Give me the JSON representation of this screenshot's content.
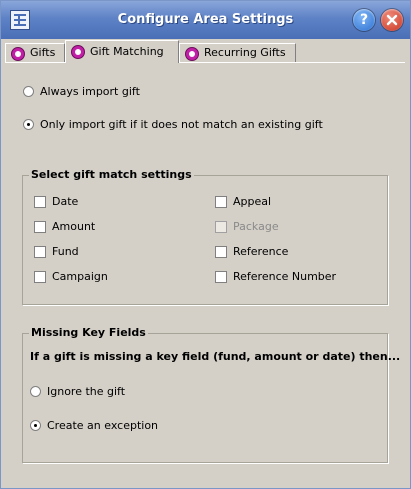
{
  "window": {
    "title": "Configure Area Settings",
    "app_icon": "table-icon",
    "help_label": "?",
    "close_icon": "close-icon",
    "accent": "#4a6fb6"
  },
  "tabs": [
    {
      "label": "Gifts",
      "icon": "gift-icon",
      "active": false
    },
    {
      "label": "Gift Matching",
      "icon": "gift-icon",
      "active": true
    },
    {
      "label": "Recurring Gifts",
      "icon": "gift-icon",
      "active": false
    }
  ],
  "import_options": [
    {
      "label": "Always import gift",
      "checked": false
    },
    {
      "label": "Only import gift if it does not match an existing gift",
      "checked": true
    }
  ],
  "match_settings": {
    "legend": "Select gift match settings",
    "left": [
      {
        "label": "Date",
        "checked": false,
        "enabled": true
      },
      {
        "label": "Amount",
        "checked": false,
        "enabled": true
      },
      {
        "label": "Fund",
        "checked": false,
        "enabled": true
      },
      {
        "label": "Campaign",
        "checked": false,
        "enabled": true
      }
    ],
    "right": [
      {
        "label": "Appeal",
        "checked": false,
        "enabled": true
      },
      {
        "label": "Package",
        "checked": false,
        "enabled": false
      },
      {
        "label": "Reference",
        "checked": false,
        "enabled": true
      },
      {
        "label": "Reference Number",
        "checked": false,
        "enabled": true
      }
    ]
  },
  "missing_key_fields": {
    "legend": "Missing Key Fields",
    "description": "If a gift is missing a key field (fund, amount or date) then...",
    "options": [
      {
        "label": "Ignore the gift",
        "checked": false
      },
      {
        "label": "Create an exception",
        "checked": true
      }
    ]
  }
}
